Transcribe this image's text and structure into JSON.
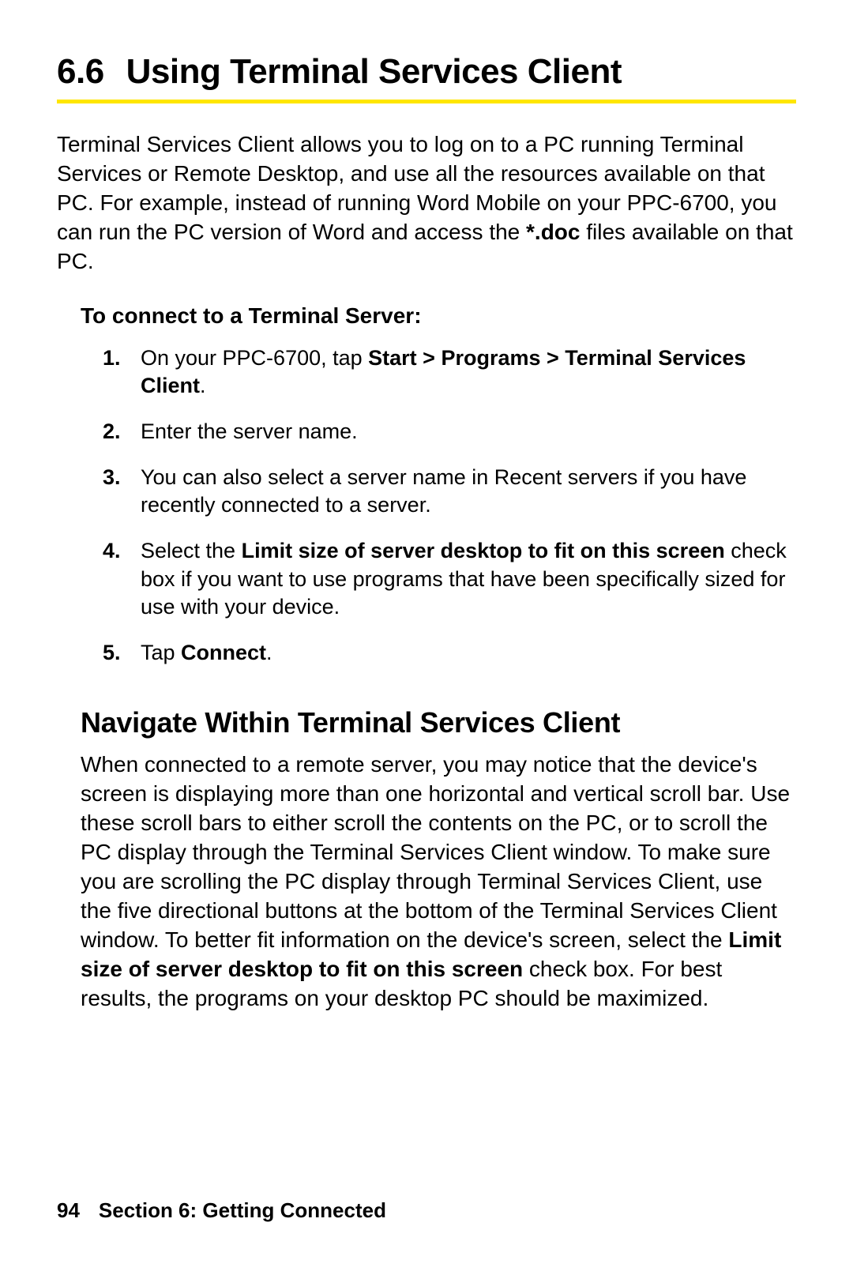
{
  "heading": {
    "number": "6.6",
    "title": "Using Terminal Services Client"
  },
  "intro": {
    "pre": "Terminal Services Client allows you to log on to a PC running Terminal Services or Remote Desktop, and use all the resources available on that PC. For example, instead of running Word Mobile on your PPC-6700, you can run the PC version of Word and access the ",
    "bold": "*.doc",
    "post": " files available on that PC."
  },
  "procedure": {
    "title": "To connect to a Terminal Server:",
    "steps": [
      {
        "n": "1.",
        "a": "On your PPC-6700, tap ",
        "b": "Start > Programs > Terminal Services Client",
        "c": "."
      },
      {
        "n": "2.",
        "a": "Enter the server name.",
        "b": "",
        "c": ""
      },
      {
        "n": "3.",
        "a": "You can also select a server name in Recent servers if you have recently connected to a server.",
        "b": "",
        "c": ""
      },
      {
        "n": "4.",
        "a": "Select the ",
        "b": "Limit size of server desktop to fit on this screen",
        "c": " check box if you want to use programs that have been specifically sized for use with your device."
      },
      {
        "n": "5.",
        "a": "Tap ",
        "b": "Connect",
        "c": "."
      }
    ]
  },
  "section": {
    "title": "Navigate Within Terminal Services Client",
    "body_pre": "When connected to a remote server, you may notice that the device's screen is displaying more than one horizontal and vertical scroll bar. Use these scroll bars to either scroll the contents on the PC, or to scroll the PC display through the Terminal Services Client window. To make sure you are scrolling the PC display through Terminal Services Client, use the five directional buttons at the bottom of the Terminal Services Client window. To better fit information on the device's screen, select the ",
    "body_bold": "Limit size of server desktop to fit on this screen",
    "body_post": " check box. For best results, the programs on your desktop PC should be maximized."
  },
  "footer": {
    "page": "94",
    "label": "Section 6: Getting Connected"
  }
}
